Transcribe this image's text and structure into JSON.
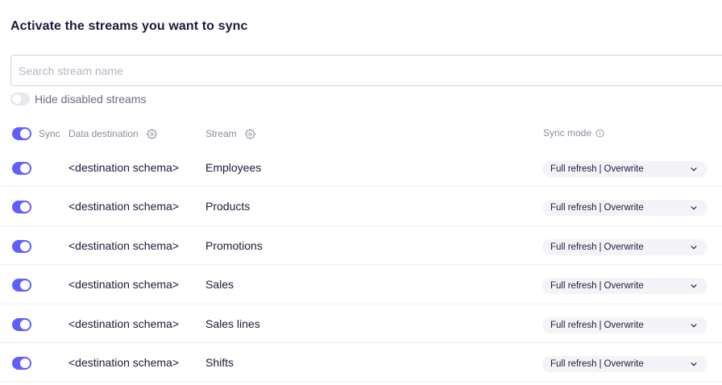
{
  "title": "Activate the streams you want to sync",
  "search": {
    "placeholder": "Search stream name",
    "value": ""
  },
  "hide_disabled": {
    "label": "Hide disabled streams",
    "enabled": false
  },
  "header": {
    "sync_label": "Sync",
    "destination_label": "Data destination",
    "stream_label": "Stream",
    "sync_mode_label": "Sync mode"
  },
  "icons": {
    "settings": "gear-icon",
    "info": "info-icon",
    "dropdown": "chevron-down-icon"
  },
  "colors": {
    "accent": "#615eff",
    "toggle_off": "#e8e9ef",
    "text": "#1a1b3a",
    "muted": "#8a8ca0"
  },
  "streams": [
    {
      "enabled": true,
      "destination": "<destination schema>",
      "stream": "Employees",
      "mode_primary": "Full refresh",
      "mode_secondary": "Overwrite"
    },
    {
      "enabled": true,
      "destination": "<destination schema>",
      "stream": "Products",
      "mode_primary": "Full refresh",
      "mode_secondary": "Overwrite"
    },
    {
      "enabled": true,
      "destination": "<destination schema>",
      "stream": "Promotions",
      "mode_primary": "Full refresh",
      "mode_secondary": "Overwrite"
    },
    {
      "enabled": true,
      "destination": "<destination schema>",
      "stream": "Sales",
      "mode_primary": "Full refresh",
      "mode_secondary": "Overwrite"
    },
    {
      "enabled": true,
      "destination": "<destination schema>",
      "stream": "Sales lines",
      "mode_primary": "Full refresh",
      "mode_secondary": "Overwrite"
    },
    {
      "enabled": true,
      "destination": "<destination schema>",
      "stream": "Shifts",
      "mode_primary": "Full refresh",
      "mode_secondary": "Overwrite"
    }
  ]
}
